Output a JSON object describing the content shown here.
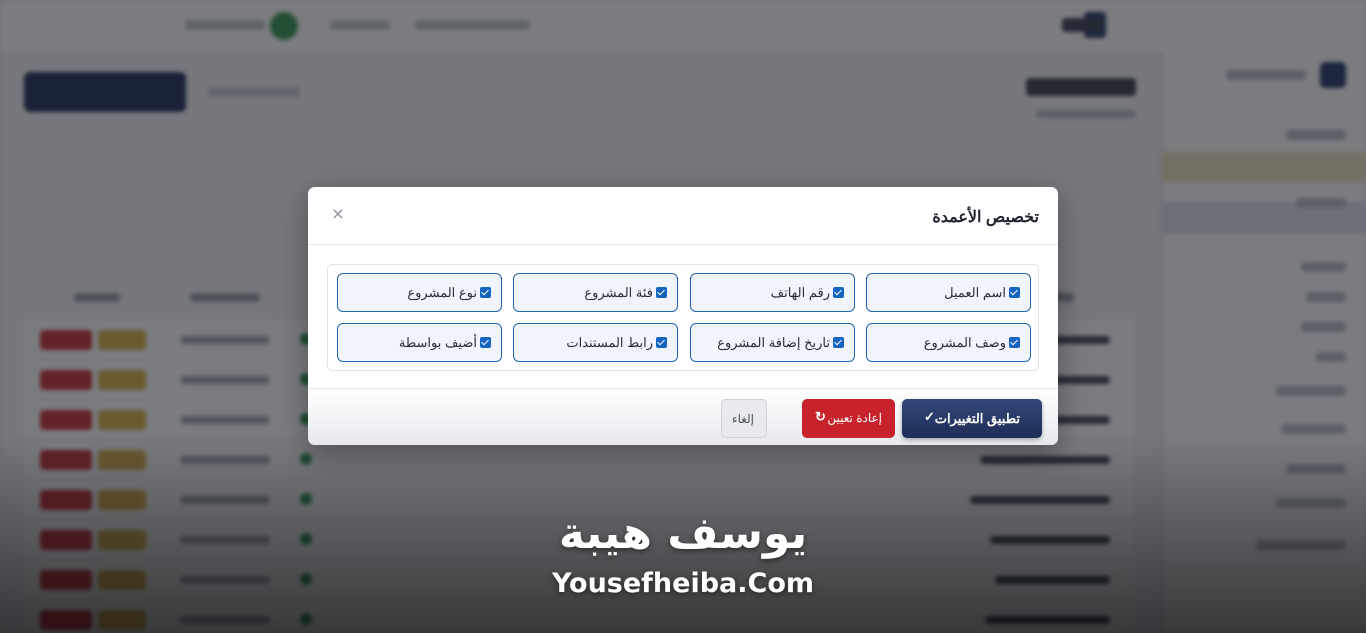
{
  "modal": {
    "title": "تخصيص الأعمدة",
    "close_symbol": "×",
    "columns": [
      {
        "label": "اسم العميل",
        "checked": true
      },
      {
        "label": "رقم الهاتف",
        "checked": true
      },
      {
        "label": "فئة المشروع",
        "checked": true
      },
      {
        "label": "نوع المشروع",
        "checked": true
      },
      {
        "label": "وصف المشروع",
        "checked": true
      },
      {
        "label": "تاريخ إضافة المشروع",
        "checked": true
      },
      {
        "label": "رابط المستندات",
        "checked": true
      },
      {
        "label": "أضيف بواسطة",
        "checked": true
      }
    ],
    "buttons": {
      "apply": "تطبيق التغييرات",
      "apply_icon": "✓",
      "reset": "إعادة تعيين",
      "reset_icon": "↻",
      "cancel": "إلغاء"
    }
  },
  "watermark": {
    "arabic": "يوسف هيبة",
    "latin": "Yousefheiba.Com"
  },
  "colors": {
    "primary": "#24345e",
    "danger": "#c8232c",
    "checkbox": "#1565c0",
    "option_border": "#1f66b3"
  }
}
